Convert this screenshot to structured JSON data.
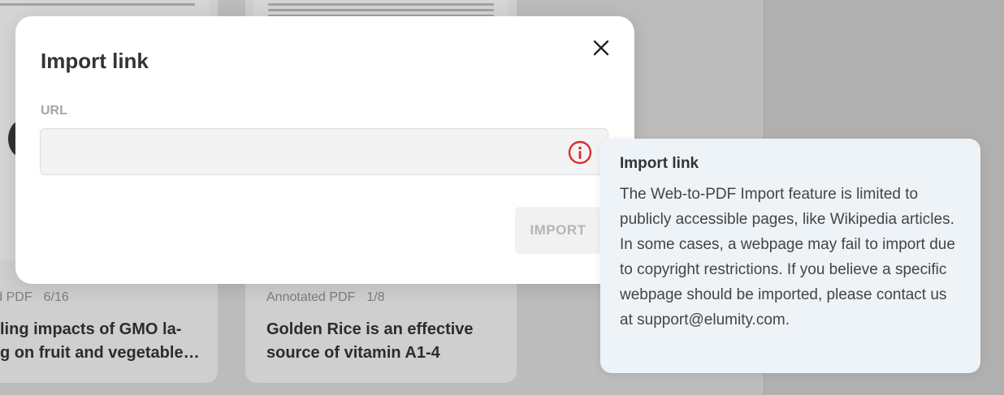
{
  "background": {
    "cards": [
      {
        "meta_type": "ated PDF",
        "meta_pages": "6/16",
        "title_line1": "ling impacts of GMO la-",
        "title_line2": "g on fruit and vegetable…"
      },
      {
        "meta_type": "Annotated PDF",
        "meta_pages": "1/8",
        "title_line1": "Golden Rice is an effective",
        "title_line2": "source of vitamin A1-4"
      }
    ]
  },
  "modal": {
    "title": "Import link",
    "close_icon": "close-icon",
    "url_label": "URL",
    "url_value": "",
    "url_placeholder": "",
    "info_icon": "info-circle-icon",
    "info_icon_color": "#d32f2f",
    "import_button": "IMPORT"
  },
  "tooltip": {
    "title": "Import link",
    "body": "The Web-to-PDF Import feature is limited to publicly accessible pages, like Wikipedia articles. In some cases, a webpage may fail to import due to copyright restrictions. If you believe a specific webpage should be imported, please contact us at support@elumity.com."
  }
}
